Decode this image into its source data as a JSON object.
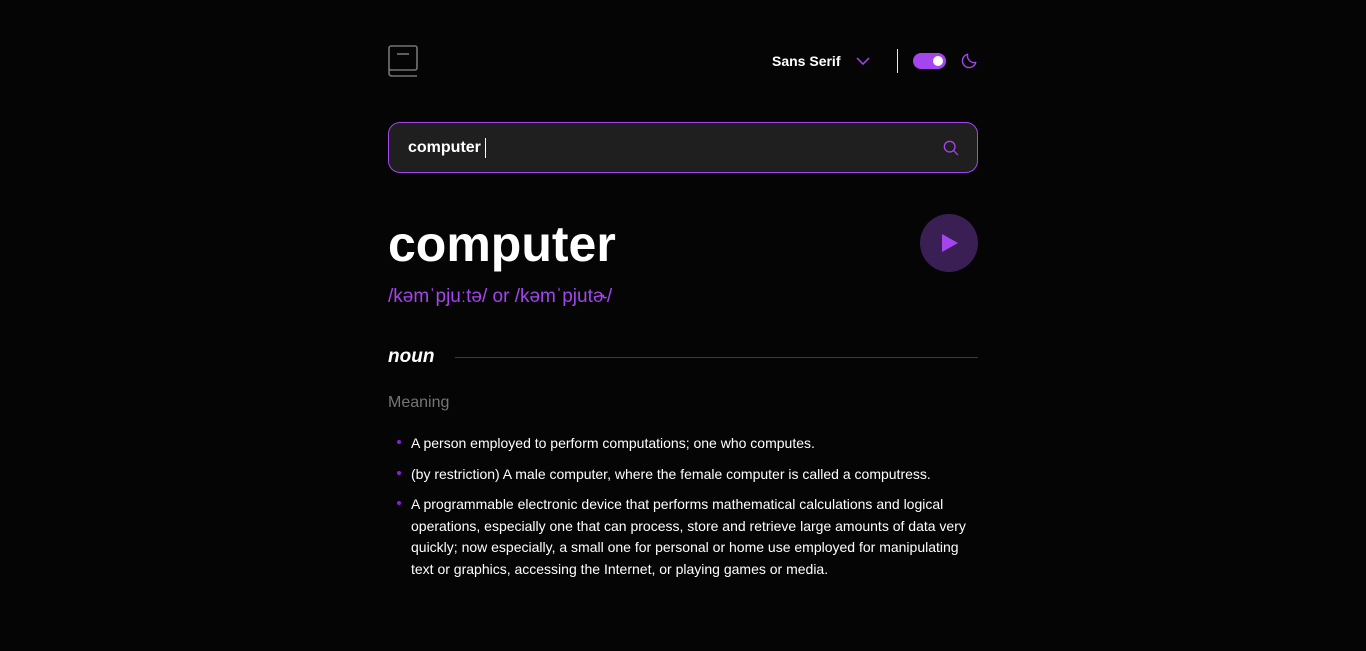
{
  "header": {
    "font_select": {
      "label": "Sans Serif"
    },
    "theme_toggle": {
      "state": "dark",
      "on": true
    }
  },
  "search": {
    "value": "computer",
    "placeholder": ""
  },
  "entry": {
    "word": "computer",
    "phonetic": "/kəmˈpjuːtə/ or /kəmˈpjutɚ/",
    "meanings": [
      {
        "part_of_speech": "noun",
        "meaning_label": "Meaning",
        "definitions": [
          "A person employed to perform computations; one who computes.",
          "(by restriction) A male computer, where the female computer is called a computress.",
          "A programmable electronic device that performs mathematical calculations and logical operations, especially one that can process, store and retrieve large amounts of data very quickly; now especially, a small one for personal or home use employed for manipulating text or graphics, accessing the Internet, or playing games or media."
        ]
      }
    ]
  },
  "colors": {
    "accent": "#a445ed",
    "background": "#050505",
    "input_bg": "#1f1f1f",
    "muted": "#757575"
  },
  "icons": [
    "book-logo-icon",
    "chevron-down-icon",
    "moon-icon",
    "search-icon",
    "play-icon"
  ]
}
